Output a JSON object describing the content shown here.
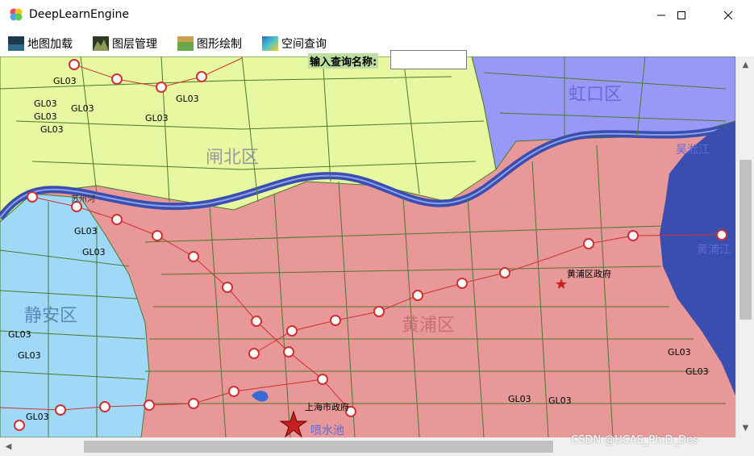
{
  "window": {
    "title": "DeepLearnEngine"
  },
  "menu": [
    {
      "label": "地图加载",
      "icon": "map-load-icon"
    },
    {
      "label": "图层管理",
      "icon": "layer-manage-icon"
    },
    {
      "label": "图形绘制",
      "icon": "draw-shape-icon"
    },
    {
      "label": "空间查询",
      "icon": "spatial-query-icon"
    }
  ],
  "query": {
    "label": "输入查询名称:",
    "value": ""
  },
  "map": {
    "districts": [
      "虹口区",
      "闸北区",
      "静安区",
      "黄浦区"
    ],
    "river_labels": [
      "苏州河",
      "吴淞江",
      "黄浦江"
    ],
    "places": [
      "黄浦区政府",
      "上海市政府",
      "喷水池"
    ],
    "station_label": "GL03",
    "colors": {
      "zabei": "#e8f8a0",
      "hongkou": "#9898f8",
      "jingan": "#a0d8f8",
      "huangpu": "#e89898",
      "river": "#3a4eb0",
      "road": "#4a7a2a"
    }
  },
  "watermark": "CSDN @UCAS_Ph.D_Des"
}
